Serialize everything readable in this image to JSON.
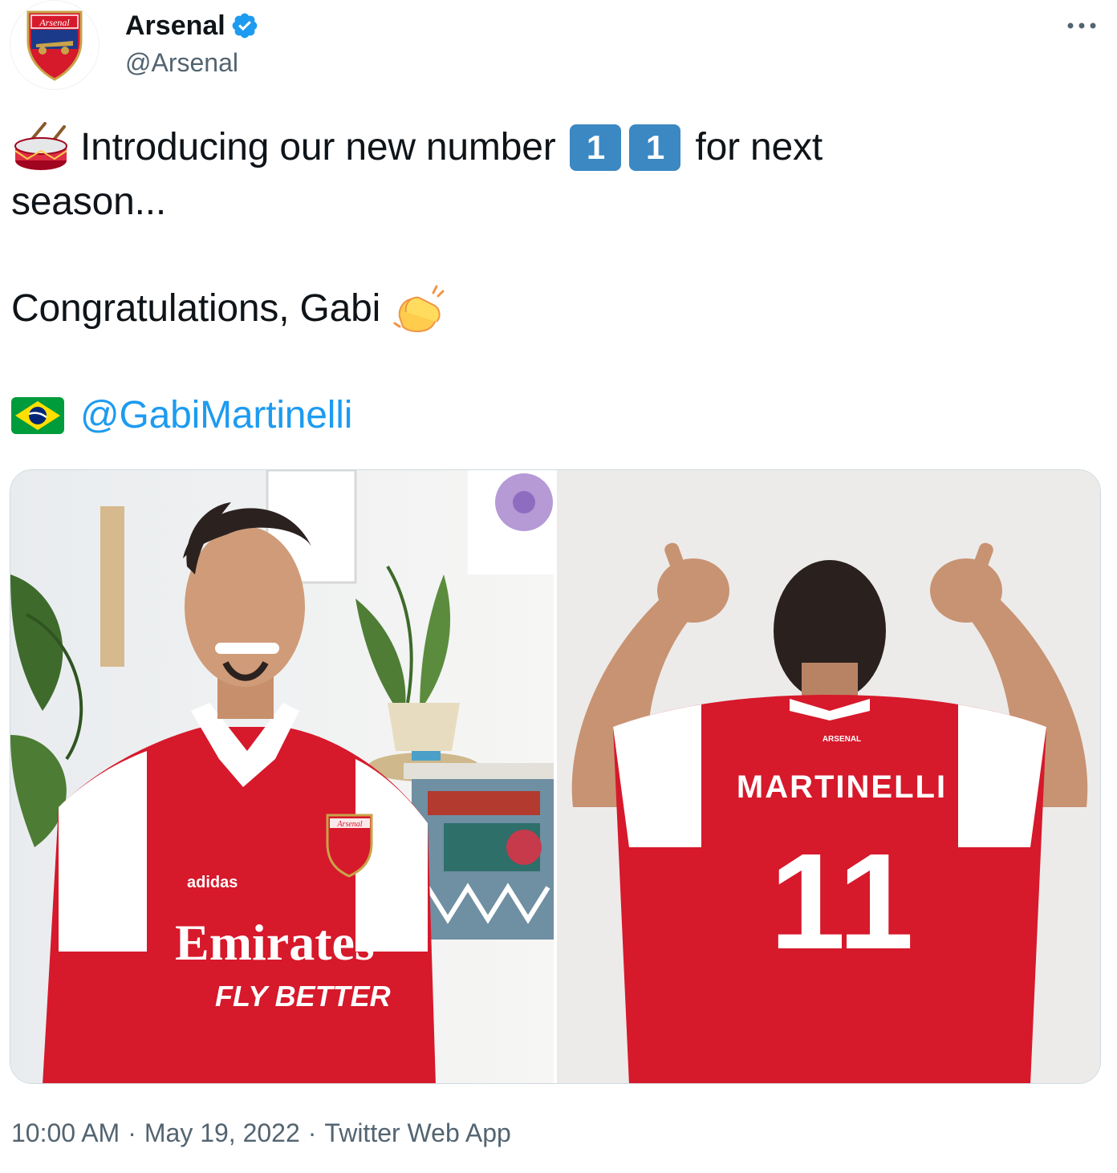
{
  "author": {
    "display_name": "Arsenal",
    "handle": "@Arsenal",
    "verified": true,
    "avatar_text": "Arsenal"
  },
  "tweet": {
    "line1_part1": "Introducing our new number",
    "keycap_digit_1": "1",
    "keycap_digit_2": "1",
    "line1_part2": "for next",
    "line2": "season...",
    "line3": "Congratulations, Gabi",
    "mention": "@GabiMartinelli"
  },
  "media": {
    "photo_left": {
      "crest_text": "Arsenal",
      "sponsor_line1": "Emirates",
      "sponsor_line2": "FLY BETTER",
      "brand": "adidas"
    },
    "photo_right": {
      "club_text": "ARSENAL",
      "shirt_name": "MARTINELLI",
      "shirt_number": "11"
    }
  },
  "meta": {
    "time": "10:00 AM",
    "date": "May 19, 2022",
    "source": "Twitter Web App",
    "separator": "·"
  },
  "colors": {
    "accent": "#1d9bf0",
    "text": "#0f1419",
    "secondary": "#536471",
    "arsenal_red": "#d6192b",
    "keycap_blue": "#3b88c3"
  }
}
